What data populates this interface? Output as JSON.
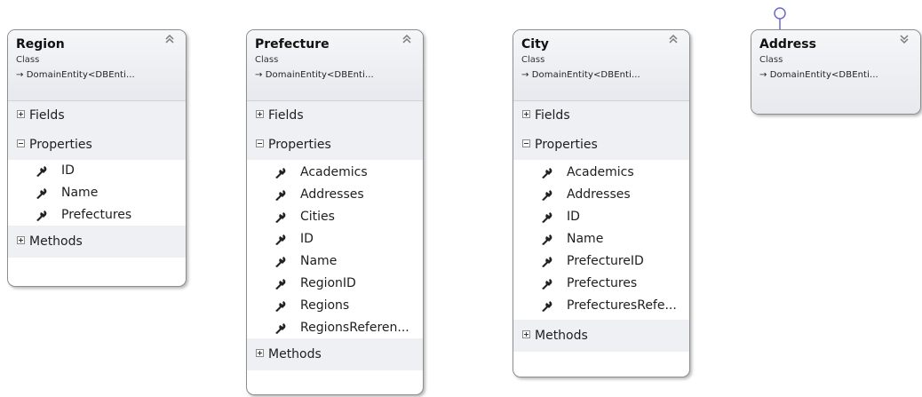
{
  "classes": [
    {
      "name": "Region",
      "kind": "Class",
      "base": "→ DomainEntity<DBEnti...",
      "toggle": "≪",
      "sections": {
        "fields": "Fields",
        "properties": "Properties",
        "methods": "Methods"
      },
      "properties": [
        "ID",
        "Name",
        "Prefectures"
      ]
    },
    {
      "name": "Prefecture",
      "kind": "Class",
      "base": "→ DomainEntity<DBEnti...",
      "toggle": "≪",
      "sections": {
        "fields": "Fields",
        "properties": "Properties",
        "methods": "Methods"
      },
      "properties": [
        "Academics",
        "Addresses",
        "Cities",
        "ID",
        "Name",
        "RegionID",
        "Regions",
        "RegionsReferen..."
      ]
    },
    {
      "name": "City",
      "kind": "Class",
      "base": "→ DomainEntity<DBEnti...",
      "toggle": "≪",
      "sections": {
        "fields": "Fields",
        "properties": "Properties",
        "methods": "Methods"
      },
      "properties": [
        "Academics",
        "Addresses",
        "ID",
        "Name",
        "PrefectureID",
        "Prefectures",
        "PrefecturesRefe..."
      ]
    },
    {
      "name": "Address",
      "kind": "Class",
      "base": "→ DomainEntity<DBEnti...",
      "toggle": "≫"
    }
  ],
  "icons": {
    "property": "wrench-icon",
    "collapse": "chevron-up-double-icon",
    "expand": "chevron-down-double-icon",
    "interface": "lollipop-interface-icon"
  },
  "colors": {
    "header_bg": "#eceef2",
    "section_bg": "#eef0f3",
    "border": "#8e8e8e",
    "interface": "#6a6ad0"
  }
}
